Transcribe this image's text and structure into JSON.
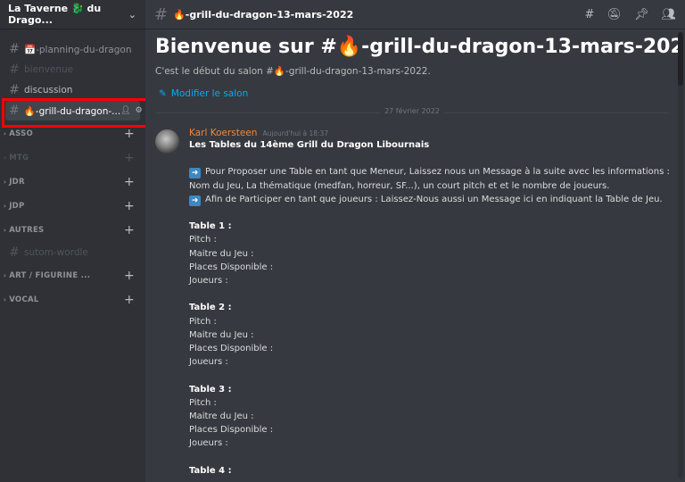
{
  "guild": {
    "name": "La Taverne 🐉 du Drago...",
    "chevron_icon": "chevron-down-icon"
  },
  "channels": [
    {
      "label": "📅-planning-du-dragon",
      "state": "normal"
    },
    {
      "label": "bienvenue",
      "state": "muted"
    },
    {
      "label": "discussion",
      "state": "light"
    },
    {
      "label": "🔥-grill-du-dragon-...",
      "state": "active"
    }
  ],
  "categories": [
    {
      "label": "ASSO",
      "state": "normal"
    },
    {
      "label": "MTG",
      "state": "muted"
    },
    {
      "label": "JDR",
      "state": "normal"
    },
    {
      "label": "JDP",
      "state": "normal"
    },
    {
      "label": "AUTRES",
      "state": "normal",
      "children": [
        {
          "label": "sutom-wordle",
          "state": "muted"
        }
      ]
    },
    {
      "label": "ART / FIGURINE ...",
      "state": "normal"
    },
    {
      "label": "VOCAL",
      "state": "normal"
    }
  ],
  "topbar": {
    "channel_name": "🔥-grill-du-dragon-13-mars-2022"
  },
  "welcome": {
    "title": "Bienvenue sur #🔥-grill-du-dragon-13-mars-2022 !",
    "subtitle": "C'est le début du salon #🔥-grill-du-dragon-13-mars-2022.",
    "edit_label": "Modifier le salon"
  },
  "date_divider": "27 février 2022",
  "message": {
    "author": "Karl Koersteen",
    "timestamp": "Aujourd'hui à 18:37",
    "lines": [
      {
        "text": "Les Tables du 14ème Grill du Dragon Libournais",
        "bold": true
      },
      {
        "text": ""
      },
      {
        "text": "Pour Proposer une Table en tant que Meneur, Laissez nous un Message à la suite avec les informations :",
        "arrow": true
      },
      {
        "text": "Nom du Jeu, La thématique (medfan, horreur, SF...), un court pitch et et le nombre de joueurs."
      },
      {
        "text": "Afin de Participer en tant que joueurs : Laissez-Nous aussi un Message ici en indiquant la Table de Jeu.",
        "arrow": true
      },
      {
        "text": ""
      },
      {
        "text": "Table 1 :",
        "bold": true
      },
      {
        "text": "Pitch :"
      },
      {
        "text": "Maitre du Jeu :"
      },
      {
        "text": "Places Disponible :"
      },
      {
        "text": "Joueurs :"
      },
      {
        "text": ""
      },
      {
        "text": "Table 2 :",
        "bold": true
      },
      {
        "text": "Pitch :"
      },
      {
        "text": "Maitre du Jeu :"
      },
      {
        "text": "Places Disponible :"
      },
      {
        "text": "Joueurs :"
      },
      {
        "text": ""
      },
      {
        "text": "Table 3 :",
        "bold": true
      },
      {
        "text": "Pitch :"
      },
      {
        "text": "Maitre du Jeu :"
      },
      {
        "text": "Places Disponible :"
      },
      {
        "text": "Joueurs :"
      },
      {
        "text": ""
      },
      {
        "text": "Table 4 :",
        "bold": true
      }
    ]
  },
  "colors": {
    "highlight": "#ff0000",
    "author": "#f0883e",
    "link": "#00aff4"
  }
}
